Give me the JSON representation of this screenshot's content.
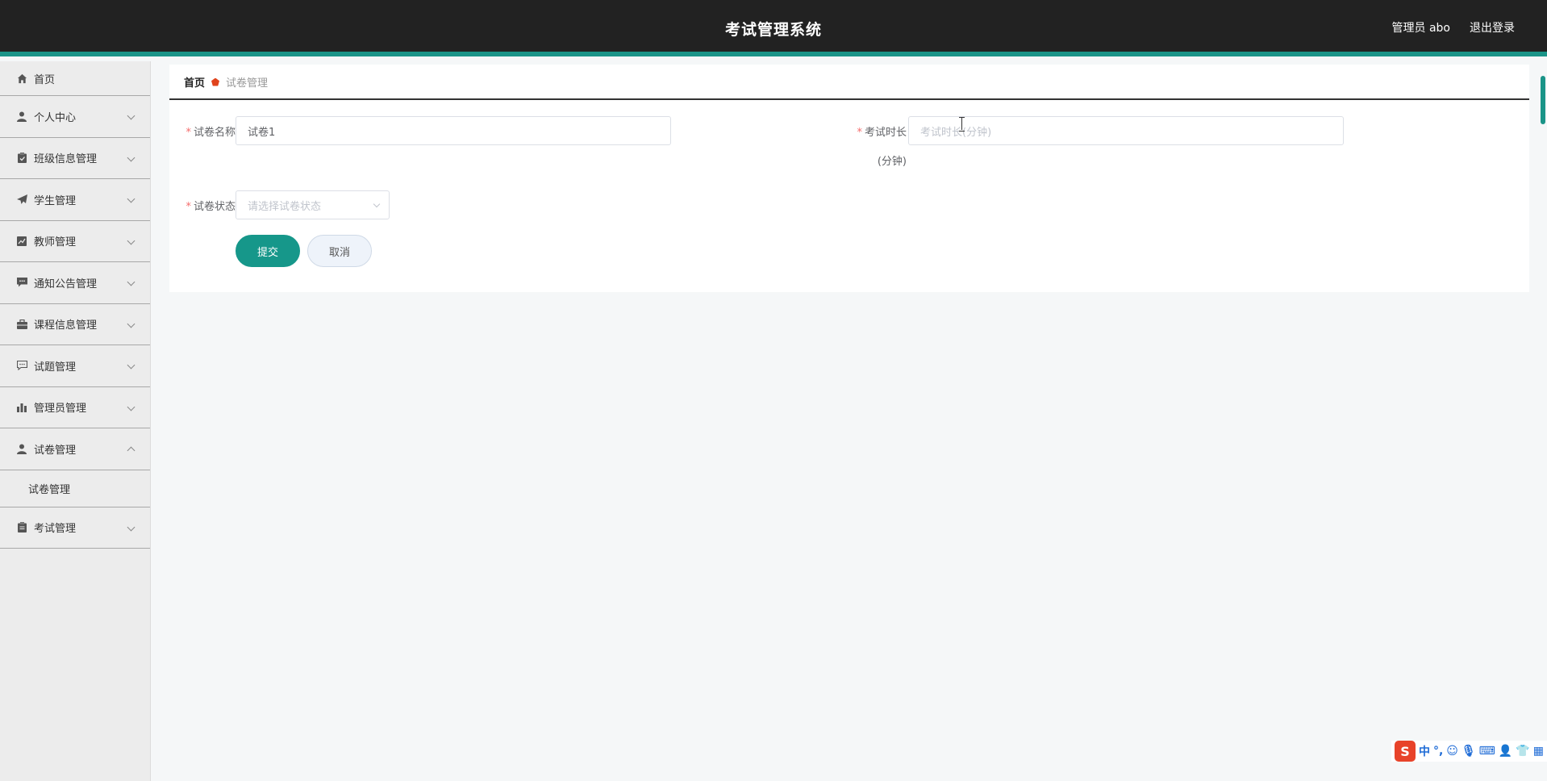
{
  "header": {
    "title": "考试管理系统",
    "user": "管理员 abo",
    "logout": "退出登录"
  },
  "sidebar": {
    "items": [
      {
        "label": "首页",
        "icon": "home-icon"
      },
      {
        "label": "个人中心",
        "icon": "user-icon"
      },
      {
        "label": "班级信息管理",
        "icon": "clipboard-icon"
      },
      {
        "label": "学生管理",
        "icon": "paper-plane-icon"
      },
      {
        "label": "教师管理",
        "icon": "chart-line-icon"
      },
      {
        "label": "通知公告管理",
        "icon": "message-icon"
      },
      {
        "label": "课程信息管理",
        "icon": "briefcase-icon"
      },
      {
        "label": "试题管理",
        "icon": "comment-icon"
      },
      {
        "label": "管理员管理",
        "icon": "bar-chart-icon"
      },
      {
        "label": "试卷管理",
        "icon": "user-icon"
      },
      {
        "label": "考试管理",
        "icon": "clipboard-icon"
      }
    ],
    "submenu": {
      "label": "试卷管理"
    }
  },
  "breadcrumb": {
    "home": "首页",
    "current": "试卷管理"
  },
  "form": {
    "name_label": "试卷名称",
    "name_value": "试卷1",
    "duration_label_line1": "考试时长",
    "duration_label_line2": "(分钟)",
    "duration_placeholder": "考试时长(分钟)",
    "status_label": "试卷状态",
    "status_placeholder": "请选择试卷状态",
    "required_mark": "*"
  },
  "buttons": {
    "submit": "提交",
    "cancel": "取消"
  },
  "ime": {
    "logo": "S",
    "mode": "中"
  },
  "colors": {
    "accent": "#16978a",
    "header_bg": "#222222",
    "breadcrumb_marker": "#e0431c"
  }
}
